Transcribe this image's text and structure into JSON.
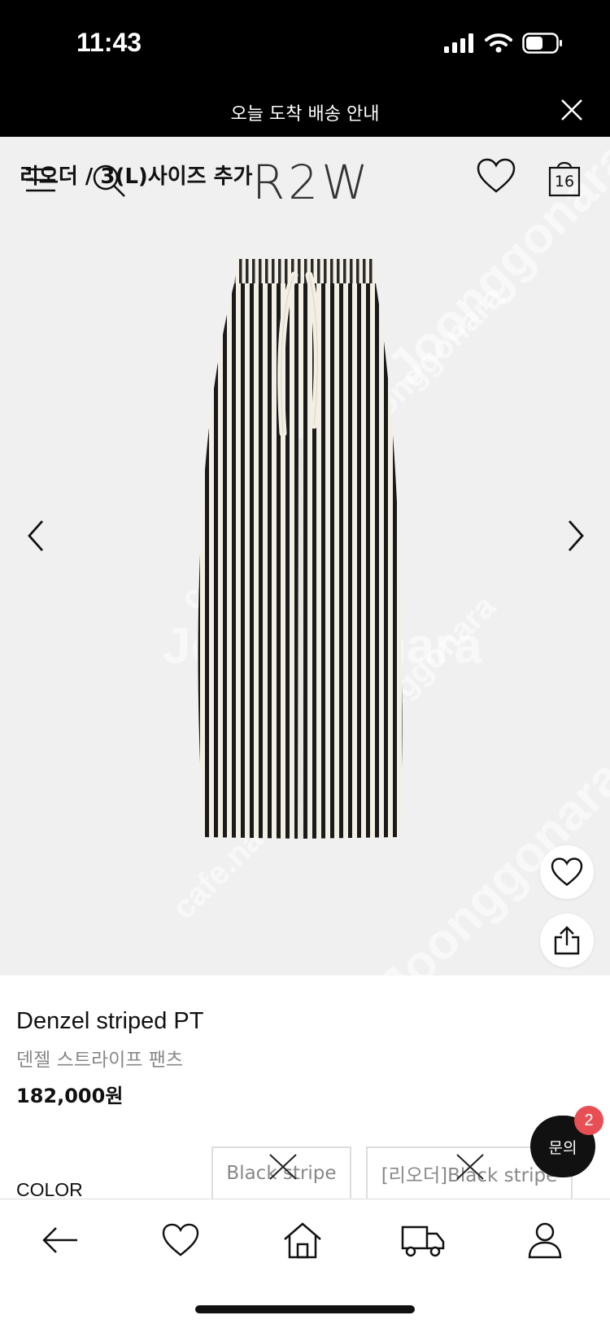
{
  "status_bar": {
    "time": "11:43"
  },
  "notice": {
    "text": "오늘 도착 배송 안내"
  },
  "header": {
    "brand": "R2W",
    "cart_count": "16"
  },
  "overlay_caption": "리오더 / 3(L)사이즈 추가",
  "watermark": {
    "text": "Joonggonara",
    "text2": "cafe.naver.com/joonggonara"
  },
  "product": {
    "name": "Denzel striped PT",
    "name_kr": "덴젤 스트라이프 팬츠",
    "price": "182,000원"
  },
  "options": {
    "label": "COLOR",
    "items": [
      {
        "label": "Black stripe",
        "sold_out": true
      },
      {
        "label": "[리오더]Black stripe",
        "sold_out": true
      }
    ]
  },
  "chat": {
    "label": "문의",
    "badge": "2"
  },
  "colors": {
    "accent_badge": "#e84f55",
    "stripe_dark": "#1a1a1a",
    "stripe_light": "#f3efe4"
  },
  "icons": [
    "menu-icon",
    "search-icon",
    "heart-icon",
    "shopping-bag-icon",
    "chevron-left-icon",
    "chevron-right-icon",
    "share-icon",
    "back-arrow-icon",
    "home-icon",
    "truck-icon",
    "user-icon",
    "close-icon"
  ]
}
